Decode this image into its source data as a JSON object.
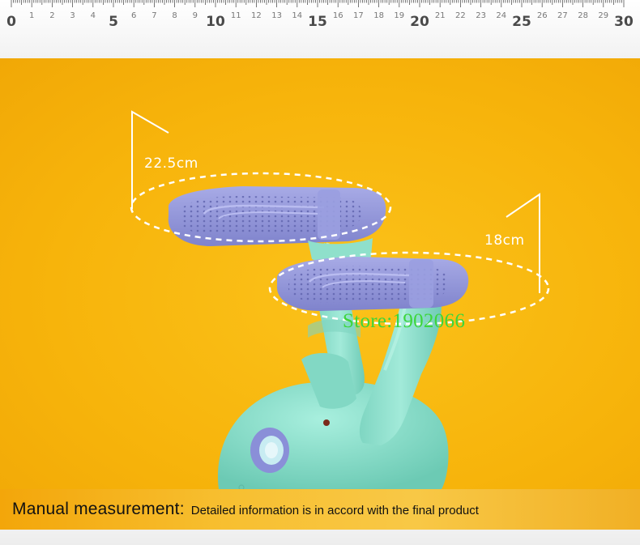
{
  "ruler": {
    "major_labels": [
      "0",
      "5",
      "10",
      "15",
      "20",
      "25",
      "30"
    ],
    "minor_labels": [
      "1",
      "2",
      "3",
      "4",
      "6",
      "7",
      "8",
      "9",
      "11",
      "12",
      "13",
      "14",
      "16",
      "17",
      "18",
      "19",
      "21",
      "22",
      "23",
      "24",
      "26",
      "27",
      "28",
      "29"
    ]
  },
  "measurements": {
    "back_pad": "22.5cm",
    "front_pad": "18cm"
  },
  "watermark": "Store:1902066",
  "banner": {
    "lead": "Manual measurement:",
    "detail": "Detailed information is in accord with the final product"
  },
  "colors": {
    "background_yellow": "#f7b40b",
    "device_mint": "#8ee0cd",
    "pad_lavender": "#8f93d6",
    "watermark_green": "#3cd63a"
  }
}
